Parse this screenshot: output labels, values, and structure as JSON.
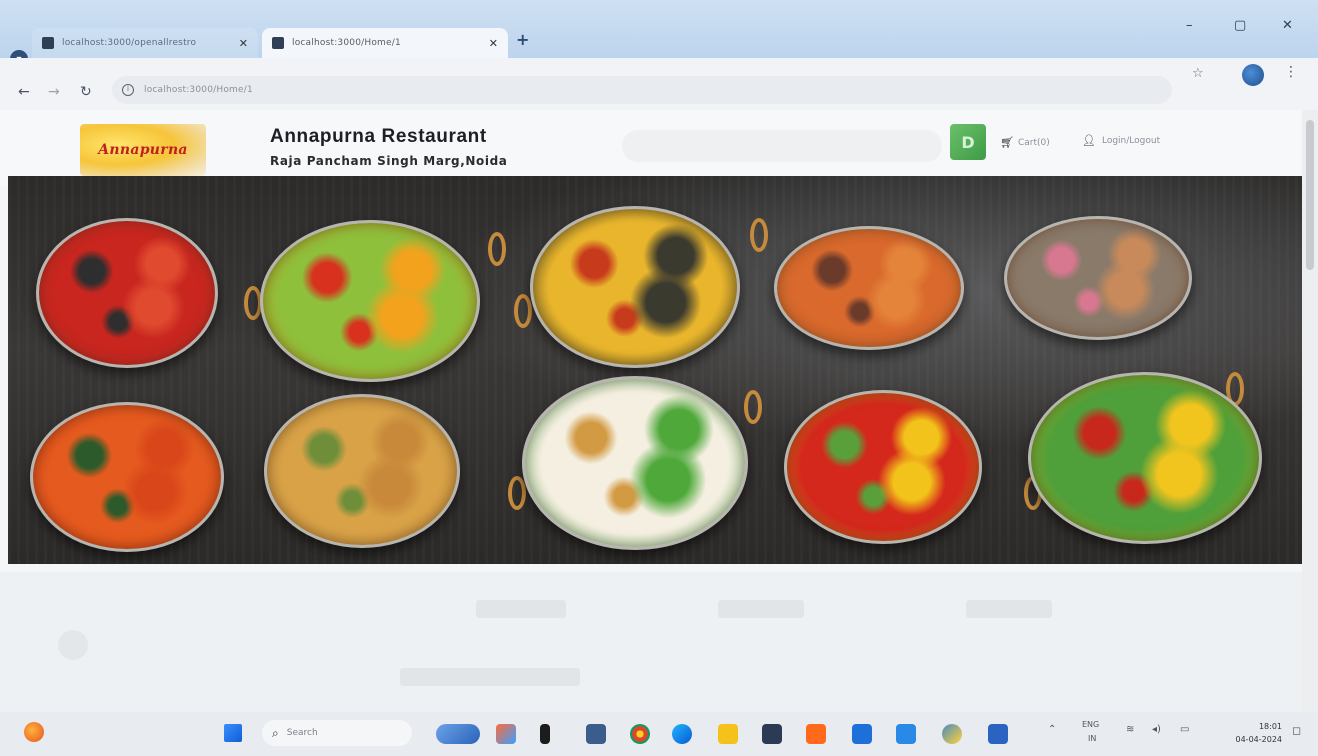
{
  "browser": {
    "tabs": [
      {
        "title": "localhost:3000/openallrestro",
        "active": false
      },
      {
        "title": "localhost:3000/Home/1",
        "active": true
      }
    ],
    "url": "localhost:3000/Home/1",
    "new_tab_glyph": "+",
    "close_glyph": "✕",
    "window_controls": {
      "minimize": "–",
      "maximize": "▢",
      "close": "✕"
    },
    "icons": [
      "back-icon",
      "forward-icon",
      "reload-icon",
      "info-icon",
      "star-icon",
      "profile-icon",
      "kebab-menu-icon"
    ]
  },
  "site": {
    "logo_text": "Annapurna",
    "restaurant_name": "Annapurna Restaurant",
    "address": "Raja Pancham Singh Marg,Noida",
    "avatar_letter": "D",
    "cart_label": "Cart(0)",
    "login_label": "Login/Logout"
  },
  "colors": {
    "accent_green": "#4caf50",
    "logo_red": "#c0201e",
    "logo_yellow": "#f6c53a"
  },
  "hero": {
    "image_alt": "Indian food dishes in serving bowls",
    "dishes": [
      {
        "colors": [
          "#c8261f",
          "#e04a2e",
          "#2e2e2e"
        ]
      },
      {
        "colors": [
          "#8fc03c",
          "#f2a21d",
          "#d8311e"
        ]
      },
      {
        "colors": [
          "#e8b52c",
          "#3b3a2f",
          "#c73a1c"
        ]
      },
      {
        "colors": [
          "#d9692c",
          "#e4843a",
          "#6a3a2a"
        ]
      },
      {
        "colors": [
          "#8a7a6a",
          "#c88a5a",
          "#d87890"
        ]
      },
      {
        "colors": [
          "#e55a1e",
          "#d8461a",
          "#2d5a2a"
        ]
      },
      {
        "colors": [
          "#d9a247",
          "#c8893a",
          "#6e8e3a"
        ]
      },
      {
        "colors": [
          "#f4efe0",
          "#4ea83a",
          "#d39a44"
        ]
      },
      {
        "colors": [
          "#d5281c",
          "#f2c31a",
          "#5aa03a"
        ]
      },
      {
        "colors": [
          "#4fa03a",
          "#f2c51e",
          "#c8281c"
        ]
      }
    ]
  },
  "taskbar": {
    "search_placeholder": "Search",
    "tray_lang": "ENG",
    "tray_region": "IN",
    "time": "18:01",
    "date": "04-04-2024"
  }
}
